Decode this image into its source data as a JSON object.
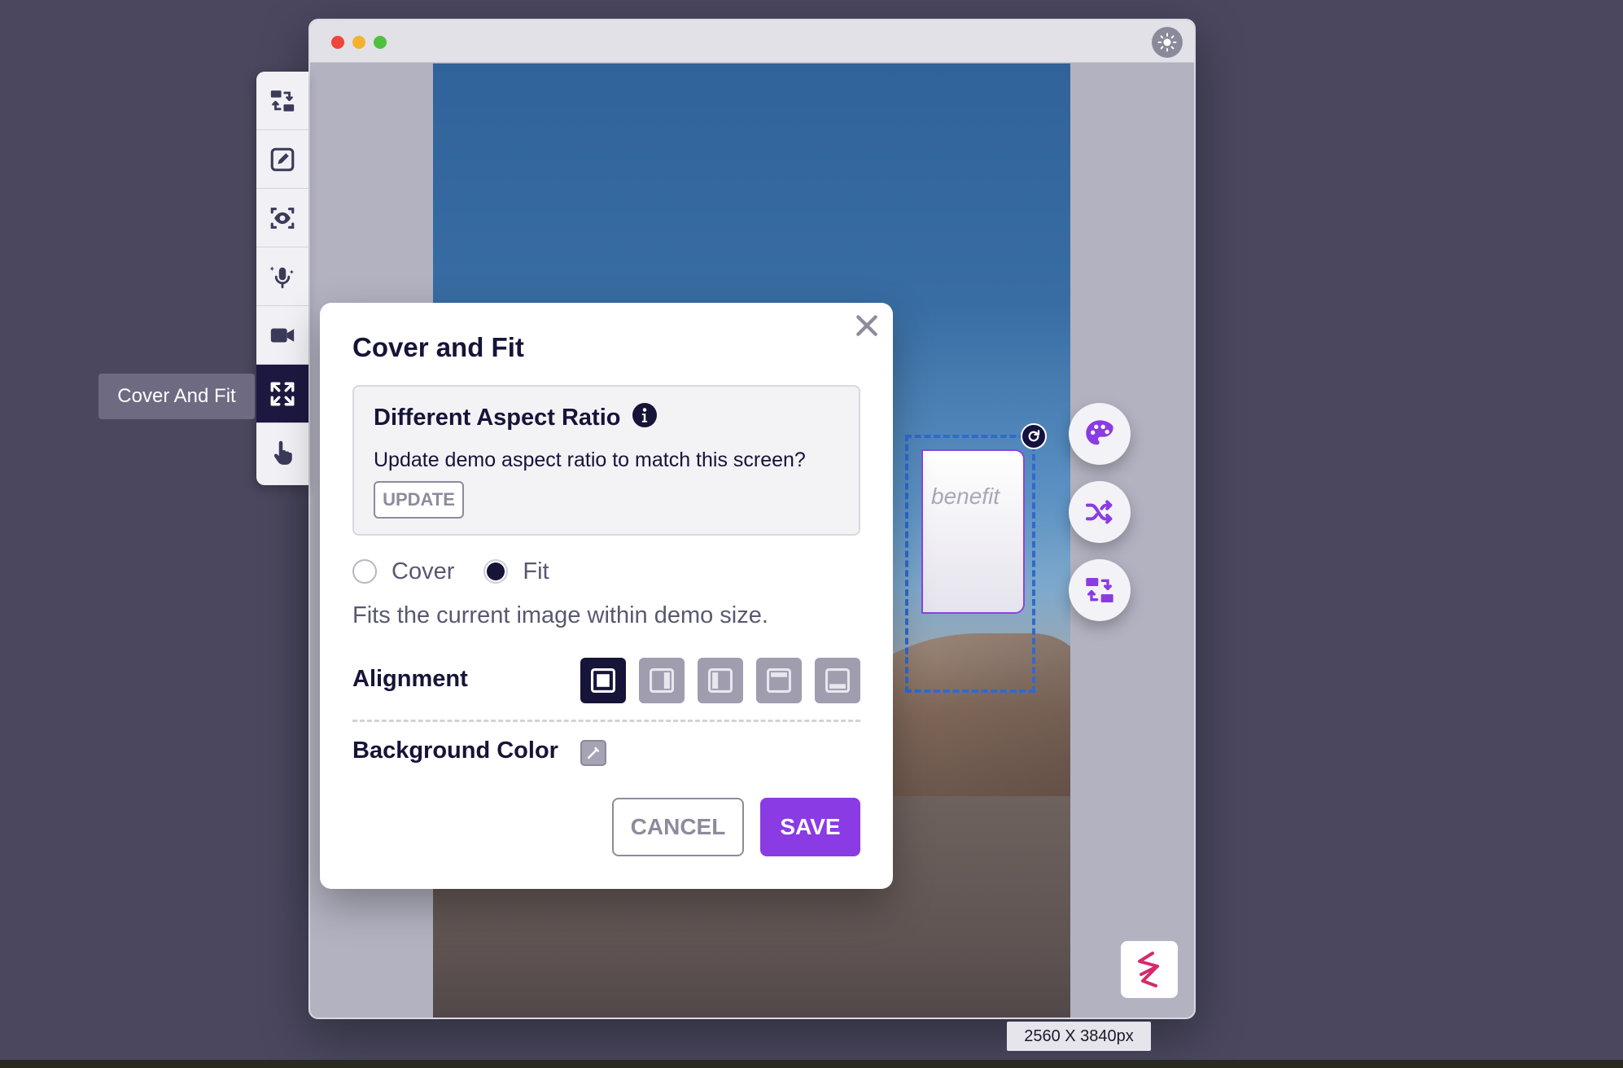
{
  "toolbar": {
    "items": [
      {
        "icon": "swap-screens-icon"
      },
      {
        "icon": "edit-icon"
      },
      {
        "icon": "preview-icon"
      },
      {
        "icon": "ai-voice-icon"
      },
      {
        "icon": "video-icon"
      },
      {
        "icon": "expand-icon",
        "active": true
      },
      {
        "icon": "hand-pointer-icon"
      }
    ],
    "tooltip": "Cover And Fit"
  },
  "canvas": {
    "hotspot_text": "benefit",
    "size_label": "2560 X 3840px"
  },
  "modal": {
    "title": "Cover and Fit",
    "aspect": {
      "title": "Different Aspect Ratio",
      "text": "Update demo aspect ratio to match this screen?",
      "update_label": "UPDATE"
    },
    "options": {
      "cover_label": "Cover",
      "fit_label": "Fit",
      "selected": "Fit"
    },
    "description": "Fits the current image within demo size.",
    "alignment_label": "Alignment",
    "background_label": "Background Color",
    "cancel_label": "CANCEL",
    "save_label": "SAVE"
  },
  "colors": {
    "accent": "#8a3be3",
    "dark": "#161438",
    "selection": "#2e6ad0"
  }
}
